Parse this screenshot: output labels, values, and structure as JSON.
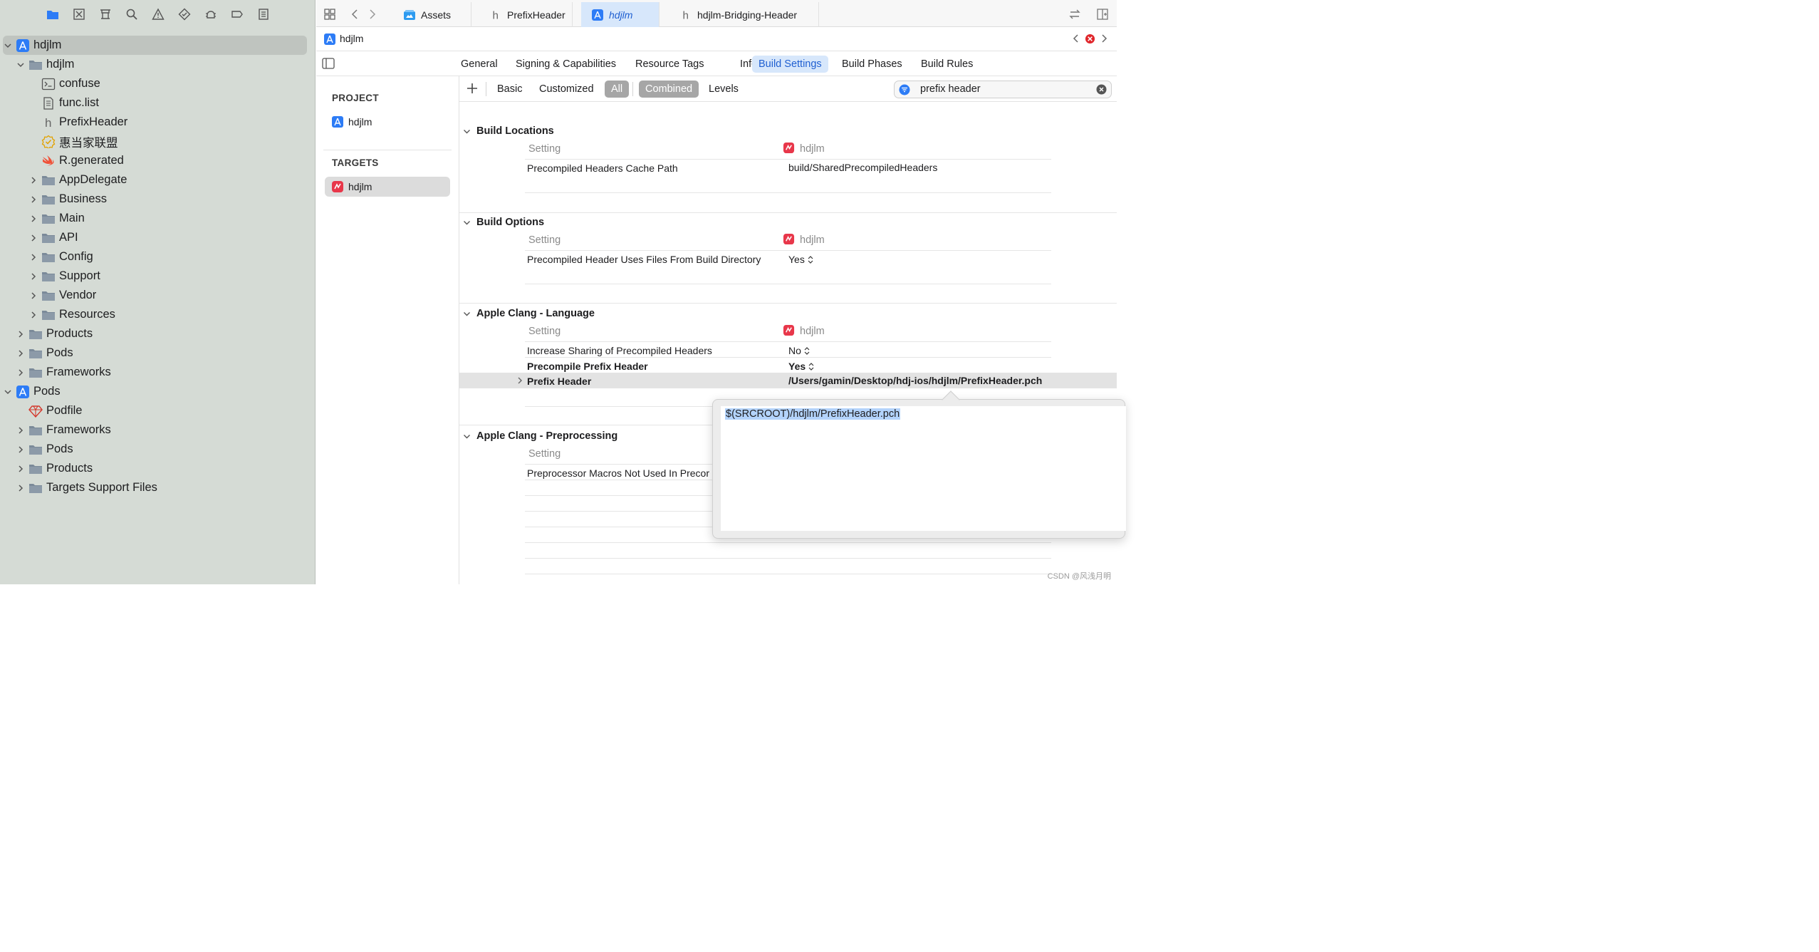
{
  "navigator": {
    "toolbar_icons": [
      "folder-icon",
      "source-control-icon",
      "symbol-icon",
      "search-icon",
      "issue-icon",
      "test-icon",
      "debug-icon",
      "breakpoint-icon",
      "report-icon"
    ],
    "tree": [
      {
        "label": "hdjlm",
        "icon": "app-project-icon",
        "disclosure": "open"
      },
      {
        "label": "hdjlm",
        "icon": "folder-icon",
        "disclosure": "open"
      },
      {
        "label": "confuse",
        "icon": "terminal-file-icon",
        "disclosure": "none"
      },
      {
        "label": "func.list",
        "icon": "text-file-icon",
        "disclosure": "none"
      },
      {
        "label": "PrefixHeader",
        "icon": "header-file-icon",
        "disclosure": "none"
      },
      {
        "label": "惠当家联盟",
        "icon": "badge-icon",
        "disclosure": "none"
      },
      {
        "label": "R.generated",
        "icon": "swift-file-icon",
        "disclosure": "none"
      },
      {
        "label": "AppDelegate",
        "icon": "folder-icon",
        "disclosure": "closed"
      },
      {
        "label": "Business",
        "icon": "folder-icon",
        "disclosure": "closed"
      },
      {
        "label": "Main",
        "icon": "folder-icon",
        "disclosure": "closed"
      },
      {
        "label": "API",
        "icon": "folder-icon",
        "disclosure": "closed"
      },
      {
        "label": "Config",
        "icon": "folder-icon",
        "disclosure": "closed"
      },
      {
        "label": "Support",
        "icon": "folder-icon",
        "disclosure": "closed"
      },
      {
        "label": "Vendor",
        "icon": "folder-icon",
        "disclosure": "closed"
      },
      {
        "label": "Resources",
        "icon": "folder-icon",
        "disclosure": "closed"
      },
      {
        "label": "Products",
        "icon": "folder-icon",
        "disclosure": "closed"
      },
      {
        "label": "Pods",
        "icon": "folder-icon",
        "disclosure": "closed"
      },
      {
        "label": "Frameworks",
        "icon": "folder-icon",
        "disclosure": "closed"
      },
      {
        "label": "Pods",
        "icon": "app-project-icon",
        "disclosure": "open"
      },
      {
        "label": "Podfile",
        "icon": "ruby-file-icon",
        "disclosure": "none"
      },
      {
        "label": "Frameworks",
        "icon": "folder-icon",
        "disclosure": "closed"
      },
      {
        "label": "Pods",
        "icon": "folder-icon",
        "disclosure": "closed"
      },
      {
        "label": "Products",
        "icon": "folder-icon",
        "disclosure": "closed"
      },
      {
        "label": "Targets Support Files",
        "icon": "folder-icon",
        "disclosure": "closed"
      }
    ]
  },
  "tabbar": {
    "tabs": [
      {
        "label": "Assets",
        "icon": "asset-catalog-icon",
        "active": false
      },
      {
        "label": "PrefixHeader",
        "icon": "header-file-icon",
        "active": false
      },
      {
        "label": "hdjlm",
        "icon": "app-project-icon",
        "active": true
      },
      {
        "label": "hdjlm-Bridging-Header",
        "icon": "header-file-icon",
        "active": false
      }
    ]
  },
  "jumpbar": {
    "label": "hdjlm"
  },
  "editor_tabs": [
    "General",
    "Signing & Capabilities",
    "Resource Tags",
    "Info",
    "Build Settings",
    "Build Phases",
    "Build Rules"
  ],
  "editor_tab_active": "Build Settings",
  "project_list": {
    "project_heading": "PROJECT",
    "project_item": "hdjlm",
    "targets_heading": "TARGETS",
    "target_item": "hdjlm"
  },
  "filter": {
    "buttons": [
      "Basic",
      "Customized",
      "All",
      "Combined",
      "Levels"
    ],
    "active": [
      "All",
      "Combined"
    ],
    "search_value": "prefix header"
  },
  "sections": {
    "build_locations": {
      "title": "Build Locations",
      "setting_header": "Setting",
      "target_header": "hdjlm",
      "rows": [
        {
          "name": "Precompiled Headers Cache Path",
          "value": "build/SharedPrecompiledHeaders"
        }
      ]
    },
    "build_options": {
      "title": "Build Options",
      "setting_header": "Setting",
      "target_header": "hdjlm",
      "rows": [
        {
          "name": "Precompiled Header Uses Files From Build Directory",
          "value": "Yes"
        }
      ]
    },
    "clang_language": {
      "title": "Apple Clang - Language",
      "setting_header": "Setting",
      "target_header": "hdjlm",
      "rows": [
        {
          "name": "Increase Sharing of Precompiled Headers",
          "value": "No"
        },
        {
          "name": "Precompile Prefix Header",
          "value": "Yes"
        },
        {
          "name": "Prefix Header",
          "value": "/Users/gamin/Desktop/hdj-ios/hdjlm/PrefixHeader.pch"
        }
      ]
    },
    "clang_preprocessing": {
      "title": "Apple Clang - Preprocessing",
      "setting_header": "Setting",
      "rows": [
        {
          "name": "Preprocessor Macros Not Used In Precor",
          "value": ""
        }
      ]
    }
  },
  "popover": {
    "value": "$(SRCROOT)/hdjlm/PrefixHeader.pch"
  },
  "watermark": "CSDN @风浅月明",
  "colors": {
    "accent": "#1f5fd1",
    "tab_active_bg": "#d7e7fb",
    "navigator_bg": "#d5dbd5",
    "selection": "#b3d3fb",
    "target_red": "#e8374a"
  }
}
